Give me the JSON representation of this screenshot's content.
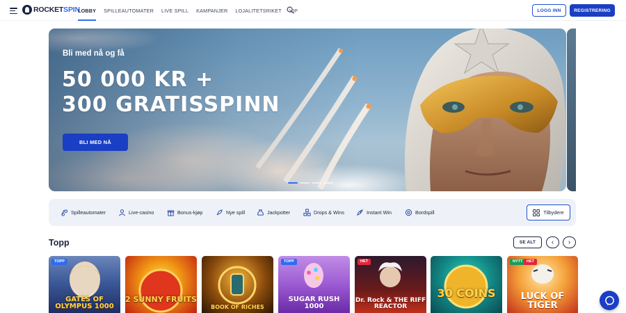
{
  "header": {
    "logo_text_a": "ROCKET",
    "logo_text_b": "SPIN",
    "nav": [
      "LOBBY",
      "SPILLEAUTOMATER",
      "LIVE SPILL",
      "KAMPANJER",
      "LOJALITETSRIKET",
      "VIP"
    ],
    "login_label": "LOGG INN",
    "register_label": "REGISTRERING"
  },
  "hero": {
    "subtitle": "Bli med nå og få",
    "title_line1": "50 000 KR +",
    "title_line2": "300 GRATISSPINN",
    "cta_label": "BLI MED NÅ"
  },
  "categories": [
    "Spilleautomater",
    "Live-casino",
    "Bonus-kjøp",
    "Nye spill",
    "Jackpotter",
    "Drops & Wins",
    "Instant Win",
    "Bordspill"
  ],
  "providers_label": "Tilbydere",
  "top_section": {
    "title": "Topp",
    "see_all_label": "SE ALT",
    "prev_icon": "‹",
    "next_icon": "›"
  },
  "games": [
    {
      "name": "GATES OF OLYMPUS 1000",
      "tags": [
        "TOPP"
      ]
    },
    {
      "name": "2 SUNNY FRUITS",
      "tags": []
    },
    {
      "name": "BOOK OF RICHES",
      "tags": []
    },
    {
      "name": "SUGAR RUSH 1000",
      "tags": [
        "TOPP"
      ]
    },
    {
      "name": "Dr. Rock & THE RIFF REACTOR",
      "tags": [
        "HET"
      ]
    },
    {
      "name": "30 COINS",
      "tags": []
    },
    {
      "name": "LUCK OF TIGER",
      "tags": [
        "NYTT",
        "HET"
      ]
    }
  ],
  "colors": {
    "brand_blue": "#1a3fc4",
    "accent_blue": "#2f6cf0",
    "navy": "#1b2340",
    "tag_red": "#e2263b",
    "tag_green": "#1c9b5a"
  }
}
